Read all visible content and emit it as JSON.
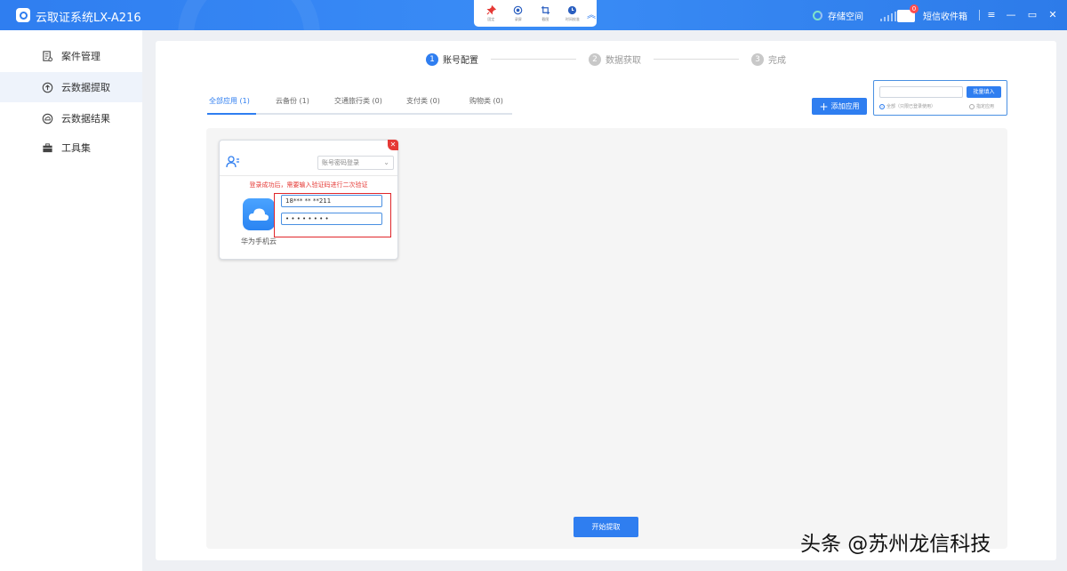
{
  "app": {
    "title": "云取证系统LX-A216"
  },
  "toolbar": {
    "tools": [
      {
        "label": "固定",
        "icon": "pin-icon"
      },
      {
        "label": "录屏",
        "icon": "record-icon"
      },
      {
        "label": "截图",
        "icon": "screenshot-icon"
      },
      {
        "label": "时间校准",
        "icon": "clock-icon"
      }
    ]
  },
  "header": {
    "storage_label": "存储空间",
    "sms_label": "短信收件箱",
    "sms_badge": "0"
  },
  "sidebar": {
    "items": [
      {
        "label": "案件管理",
        "icon": "case-icon"
      },
      {
        "label": "云数据提取",
        "icon": "cloud-upload-icon",
        "active": true
      },
      {
        "label": "云数据结果",
        "icon": "cloud-result-icon"
      },
      {
        "label": "工具集",
        "icon": "toolbox-icon"
      }
    ]
  },
  "steps": [
    {
      "num": "1",
      "label": "账号配置",
      "active": true
    },
    {
      "num": "2",
      "label": "数据获取",
      "active": false
    },
    {
      "num": "3",
      "label": "完成",
      "active": false
    }
  ],
  "tabs": [
    {
      "label": "全部应用 (1)",
      "active": true
    },
    {
      "label": "云备份 (1)"
    },
    {
      "label": "交通旅行类 (0)"
    },
    {
      "label": "支付类 (0)"
    },
    {
      "label": "购物类 (0)"
    }
  ],
  "actions": {
    "add_app": "添加应用",
    "batch_fill": "批量填入",
    "batch_input_value": "",
    "radio_all": "全部（只限已登录使用）",
    "radio_specified": "指定应用",
    "start": "开始提取"
  },
  "card": {
    "login_mode": "账号密码登录",
    "warning": "登录成功后，需要输入验证码进行二次验证",
    "app_name": "华为手机云",
    "account": "18*** ** **211",
    "password": "• • • • • • • •"
  },
  "watermark": "头条 @苏州龙信科技",
  "colors": {
    "primary": "#2f7ef0",
    "danger": "#e53935"
  }
}
